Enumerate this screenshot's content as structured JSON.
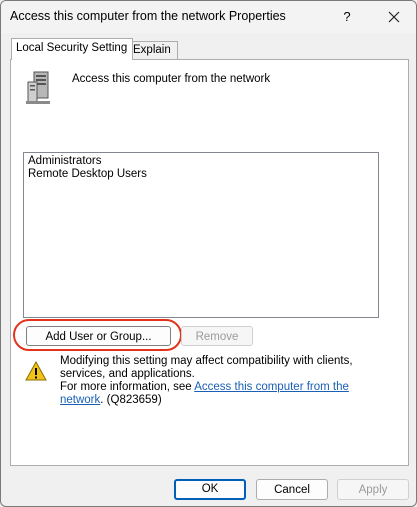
{
  "window": {
    "title": "Access this computer from the network Properties",
    "help_label": "?",
    "close_icon": "close-icon"
  },
  "tabs": [
    {
      "label": "Local Security Setting",
      "active": true
    },
    {
      "label": "Explain",
      "active": false
    }
  ],
  "policy": {
    "icon": "server-icon",
    "name": "Access this computer from the network"
  },
  "members": [
    "Administrators",
    "Remote Desktop Users"
  ],
  "buttons": {
    "add": "Add User or Group...",
    "remove": "Remove"
  },
  "warning": {
    "icon": "warning-icon",
    "line1": "Modifying this setting may affect compatibility with clients, services, and applications.",
    "line2_prefix": "For more information, see ",
    "link": "Access this computer from the network",
    "line2_suffix": ". (Q823659)"
  },
  "footer": {
    "ok": "OK",
    "cancel": "Cancel",
    "apply": "Apply"
  },
  "colors": {
    "highlight": "#e3341b",
    "link": "#1a5fb4",
    "ok_border": "#005fb8"
  }
}
